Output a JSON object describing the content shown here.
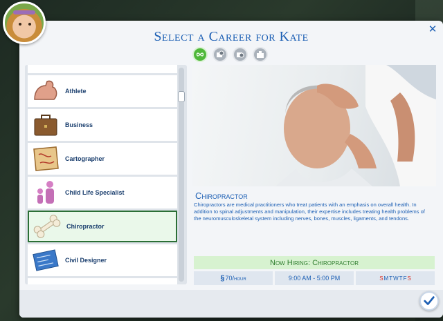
{
  "header": {
    "title": "Select a Career for Kate",
    "close_icon": "close-icon"
  },
  "career_types": [
    {
      "icon": "infinity-icon",
      "active": true
    },
    {
      "icon": "part-time-icon",
      "active": false
    },
    {
      "icon": "freelance-icon",
      "active": false
    },
    {
      "icon": "active-career-icon",
      "active": false
    }
  ],
  "careers": [
    {
      "label": "Athlete",
      "icon": "flexed-arm-icon",
      "selected": false
    },
    {
      "label": "Business",
      "icon": "briefcase-icon",
      "selected": false
    },
    {
      "label": "Cartographer",
      "icon": "map-icon",
      "selected": false
    },
    {
      "label": "Child Life Specialist",
      "icon": "parent-child-icon",
      "selected": false
    },
    {
      "label": "Chiropractor",
      "icon": "bone-icon",
      "selected": true
    },
    {
      "label": "Civil Designer",
      "icon": "blueprint-icon",
      "selected": false
    }
  ],
  "detail": {
    "name": "Chiropractor",
    "description": "Chiropractors are medical practitioners who treat patients with an emphasis on overall health. In addition to spinal adjustments and manipulation, their expertise includes treating health problems of the neuromusculoskeletal system including nerves, bones, muscles, ligaments, and tendons.",
    "hiring": "Now Hiring: Chiropractor",
    "pay_symbol": "§",
    "pay_amount": "70",
    "pay_unit": "/hour",
    "hours": "9:00 AM - 5:00 PM",
    "days": [
      "S",
      "M",
      "T",
      "W",
      "T",
      "F",
      "S"
    ],
    "days_off": [
      true,
      false,
      false,
      false,
      false,
      false,
      true
    ]
  },
  "colors": {
    "accent": "#1c5fb4",
    "hiring_bg": "#d7f2d0",
    "hiring_text": "#2e7d2e",
    "weekend": "#d9342b",
    "selected_border": "#2b6f36"
  },
  "confirm_icon": "checkmark-icon"
}
